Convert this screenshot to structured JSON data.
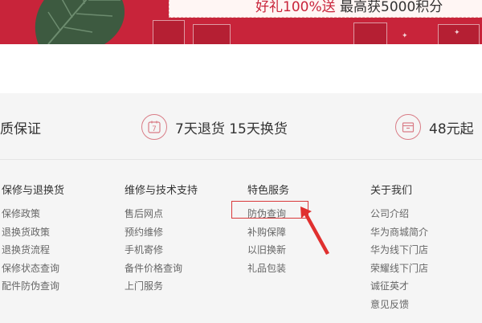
{
  "banner": {
    "promo_highlight": "好礼100%送",
    "promo_rest": "最高获5000积分"
  },
  "services": [
    {
      "label": "质保证",
      "icon": "quality-icon"
    },
    {
      "label": "7天退货 15天换货",
      "icon": "calendar-7-icon",
      "icon_text": "7"
    },
    {
      "label": "48元起",
      "icon": "package-icon"
    }
  ],
  "footer": {
    "columns": [
      {
        "heading": "保修与退换货",
        "links": [
          "保修政策",
          "退换货政策",
          "退换货流程",
          "保修状态查询",
          "配件防伪查询"
        ]
      },
      {
        "heading": "维修与技术支持",
        "links": [
          "售后网点",
          "预约维修",
          "手机寄修",
          "备件价格查询",
          "上门服务"
        ]
      },
      {
        "heading": "特色服务",
        "links": [
          "防伪查询",
          "补购保障",
          "以旧换新",
          "礼品包装"
        ]
      },
      {
        "heading": "关于我们",
        "links": [
          "公司介绍",
          "华为商城简介",
          "华为线下门店",
          "荣耀线下门店",
          "诚征英才",
          "意见反馈"
        ]
      }
    ]
  },
  "colors": {
    "brand_red": "#c8243a",
    "annotation_red": "#d9393a",
    "footer_bg": "#f5f5f5"
  }
}
